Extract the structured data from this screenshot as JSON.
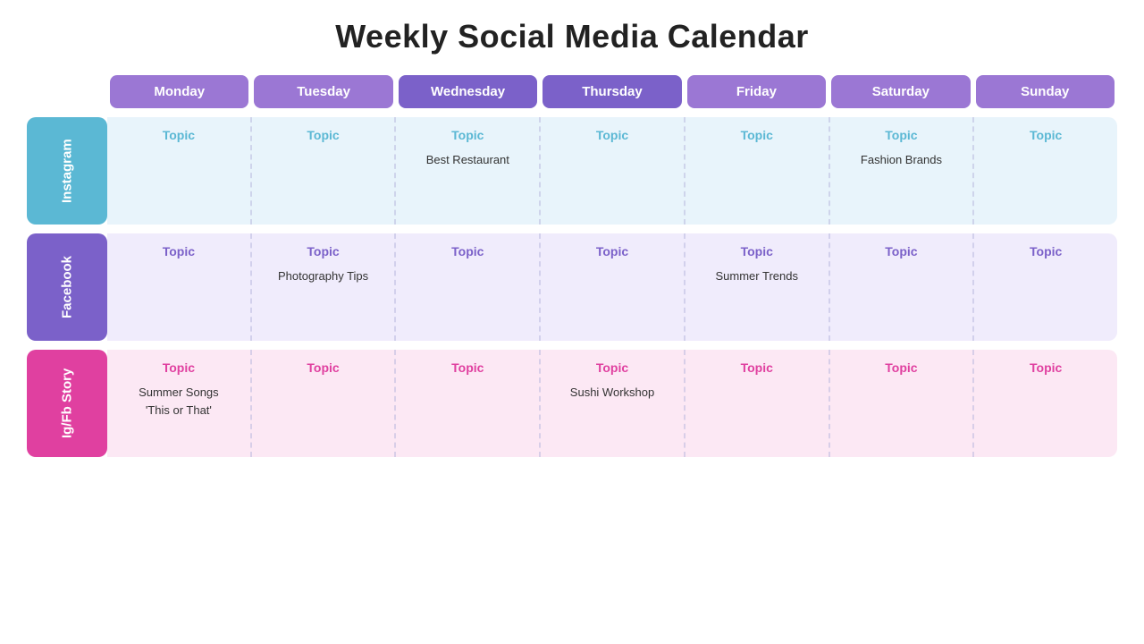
{
  "title": "Weekly Social Media Calendar",
  "days": [
    {
      "label": "Monday",
      "bg": "monday-bg"
    },
    {
      "label": "Tuesday",
      "bg": "tuesday-bg"
    },
    {
      "label": "Wednesday",
      "bg": "wednesday-bg"
    },
    {
      "label": "Thursday",
      "bg": "thursday-bg"
    },
    {
      "label": "Friday",
      "bg": "friday-bg"
    },
    {
      "label": "Saturday",
      "bg": "saturday-bg"
    },
    {
      "label": "Sunday",
      "bg": "sunday-bg"
    }
  ],
  "platforms": [
    {
      "name": "Instagram",
      "labelClass": "instagram-label",
      "gridClass": "instagram-grid",
      "topicClass": "instagram-topic",
      "topic_label": "Topic",
      "cells": [
        {
          "topic": "Topic",
          "content": ""
        },
        {
          "topic": "Topic",
          "content": ""
        },
        {
          "topic": "Topic",
          "content": "Best Restaurant"
        },
        {
          "topic": "Topic",
          "content": ""
        },
        {
          "topic": "Topic",
          "content": ""
        },
        {
          "topic": "Topic",
          "content": "Fashion Brands"
        },
        {
          "topic": "Topic",
          "content": ""
        }
      ]
    },
    {
      "name": "Facebook",
      "labelClass": "facebook-label",
      "gridClass": "facebook-grid",
      "topicClass": "facebook-topic",
      "topic_label": "Topic",
      "cells": [
        {
          "topic": "Topic",
          "content": ""
        },
        {
          "topic": "Topic",
          "content": "Photography Tips"
        },
        {
          "topic": "Topic",
          "content": ""
        },
        {
          "topic": "Topic",
          "content": ""
        },
        {
          "topic": "Topic",
          "content": "Summer Trends"
        },
        {
          "topic": "Topic",
          "content": ""
        },
        {
          "topic": "Topic",
          "content": ""
        }
      ]
    },
    {
      "name": "Ig/Fb Story",
      "labelClass": "story-label",
      "gridClass": "story-grid",
      "topicClass": "story-topic",
      "topic_label": "Topic",
      "cells": [
        {
          "topic": "Topic",
          "content": "Summer Songs\n'This or That'"
        },
        {
          "topic": "Topic",
          "content": ""
        },
        {
          "topic": "Topic",
          "content": ""
        },
        {
          "topic": "Topic",
          "content": "Sushi Workshop"
        },
        {
          "topic": "Topic",
          "content": ""
        },
        {
          "topic": "Topic",
          "content": ""
        },
        {
          "topic": "Topic",
          "content": ""
        }
      ]
    }
  ]
}
